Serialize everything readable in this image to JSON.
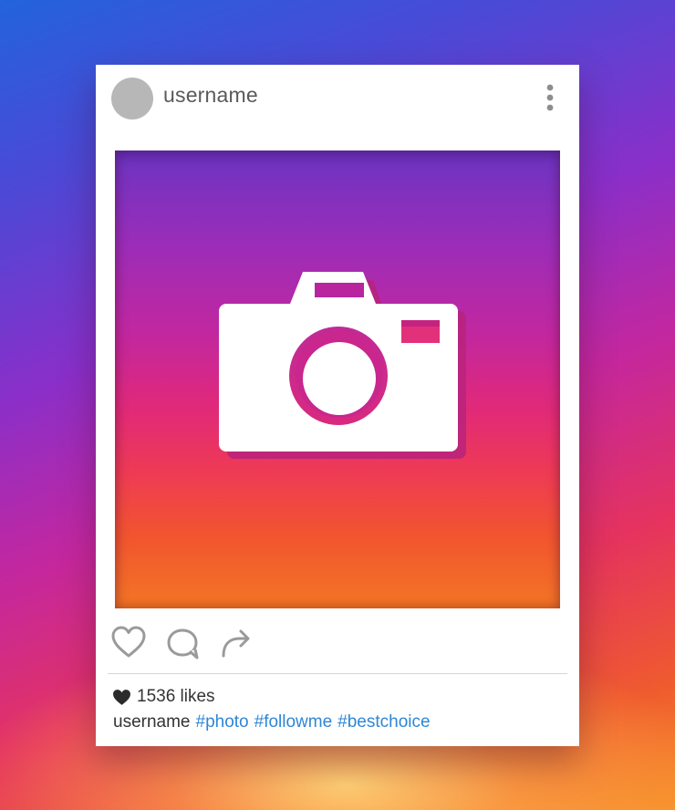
{
  "post": {
    "username": "username",
    "likes_text": "1536 likes",
    "caption_username": "username",
    "hashtags": [
      "#photo",
      "#followme",
      "#bestchoice"
    ]
  },
  "icons": {
    "more": "vertical-dots-icon",
    "photo": "camera-icon",
    "like": "heart-outline-icon",
    "comment": "comment-bubble-icon",
    "share": "share-arrow-icon",
    "likes": "heart-filled-icon"
  },
  "colors": {
    "background_gradient": [
      "#2363dc",
      "#8a2fc9",
      "#c4279e",
      "#e5335f",
      "#f69127"
    ],
    "card": "#ffffff",
    "avatar": "#b7b7b7",
    "hashtag": "#2f86d6",
    "icon_gray": "#9a9a9a"
  }
}
